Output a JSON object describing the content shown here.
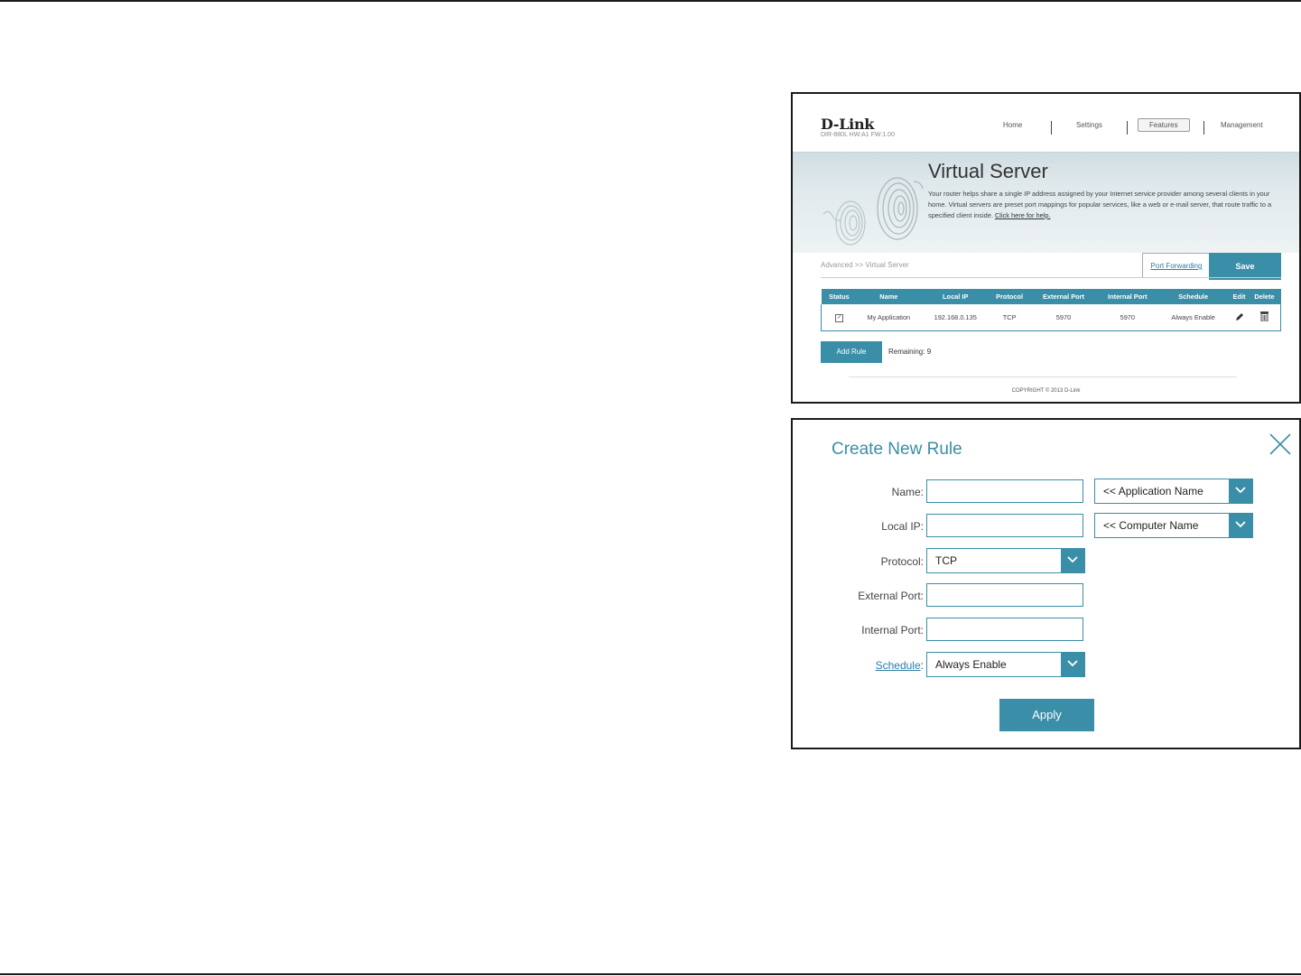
{
  "router_page": {
    "logo": "D-Link",
    "model": "DIR-880L   HW:A1   FW:1.00",
    "nav": {
      "home": "Home",
      "settings": "Settings",
      "features": "Features",
      "management": "Management",
      "active": "Features"
    },
    "banner": {
      "title": "Virtual Server",
      "description": "Your router helps share a single IP address assigned by your Internet service provider among several clients in your home. Virtual servers are preset port mappings for popular services, like a web or e-mail server, that route traffic to a specified client inside.",
      "help_link": "Click here for help."
    },
    "breadcrumb": "Advanced >> Virtual Server",
    "port_forwarding_link": "Port Forwarding",
    "save_label": "Save",
    "table": {
      "headers": {
        "status": "Status",
        "name": "Name",
        "local_ip": "Local IP",
        "protocol": "Protocol",
        "external_port": "External Port",
        "internal_port": "Internal Port",
        "schedule": "Schedule",
        "edit": "Edit",
        "delete": "Delete"
      },
      "rows": [
        {
          "status": "✓",
          "name": "My Application",
          "local_ip": "192.168.0.135",
          "protocol": "TCP",
          "external_port": "5970",
          "internal_port": "5970",
          "schedule": "Always Enable"
        }
      ]
    },
    "add_rule_label": "Add Rule",
    "remaining": "Remaining: 9",
    "copyright": "COPYRIGHT © 2013 D-Link"
  },
  "dialog": {
    "title": "Create New Rule",
    "labels": {
      "name": "Name:",
      "local_ip": "Local IP:",
      "protocol": "Protocol:",
      "external_port": "External Port:",
      "internal_port": "Internal Port:",
      "schedule_link": "Schedule",
      "schedule_colon": ":"
    },
    "values": {
      "name": "",
      "local_ip": "",
      "external_port": "",
      "internal_port": ""
    },
    "application_select": "<< Application Name",
    "computer_select": "<< Computer Name",
    "protocol_select": "TCP",
    "schedule_select": "Always Enable",
    "apply_label": "Apply"
  },
  "colors": {
    "accent": "#3a8ea7",
    "link": "#2a7ea8"
  }
}
